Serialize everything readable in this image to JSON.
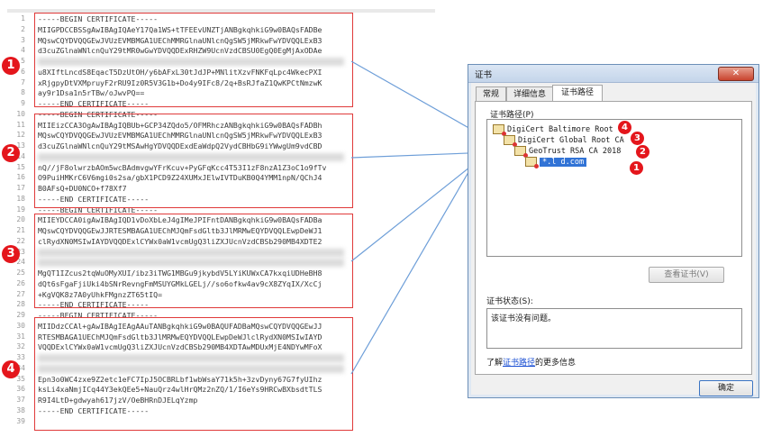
{
  "editor": {
    "line_numbers": [
      "1",
      "2",
      "3",
      "4",
      "5",
      "6",
      "7",
      "8",
      "9",
      "10",
      "11",
      "12",
      "13",
      "14",
      "15",
      "16",
      "17",
      "18",
      "19",
      "20",
      "21",
      "22",
      "23",
      "24",
      "25",
      "26",
      "27",
      "28",
      "29",
      "30",
      "31",
      "32",
      "33",
      "34",
      "35",
      "36",
      "37",
      "38",
      "39"
    ],
    "lines": [
      "-----BEGIN CERTIFICATE-----",
      "MIIGPDCCBSSgAwIBAgIQAeY17Qa1WS+tTFEEvUNZTjANBgkqhkiG9w0BAQsFADBe",
      "MQswCQYDVQQGEwJVUzEVMBMGA1UEChMMRGlnaUNlcnQgSW5jMRkwFwYDVQQLExB3",
      "d3cuZGlnaWNlcnQuY29tMR0wGwYDVQQDExRHZW9UcnVzdCBSU0EgQ0EgMjAxODAe",
      "",
      "u8XIftLncdS8EqacT5DzUtOH/y6bAFxL30tJdJP+MNlitXzvFNKFqLpc4WkecPXI",
      "xRjgpyDtVXMpruyF2rRU9Iz0R5V3G1b+Do4y9IFc8/2q+BsRJfaZ1QwKPCtNmzwK",
      "ay9r1Dsa1n5rTBw/oJwvPQ==",
      "-----END CERTIFICATE-----",
      "-----BEGIN CERTIFICATE-----",
      "MIIEizCCA3OgAwIBAgIQBUb+GCP34ZQdo5/OFMRhczANBgkqhkiG9w0BAQsFADBh",
      "MQswCQYDVQQGEwJVUzEVMBMGA1UEChMMRGlnaUNlcnQgSW5jMRkwFwYDVQQLExB3",
      "d3cuZGlnaWNlcnQuY29tMSAwHgYDVQQDExdEaWdpQ2VydCBHbG9iYWwgUm9vdCBD",
      "",
      "nQ//jF8olwrzbAOm5wcBAdmvgwYFrKcuv+PyGFqKcc4T53I1zF8nzA1Z3oC1o9fTv",
      "O9PuiHMKrC6V6mgi0s2sa/gbX1PCD9Z24XUMxJElwIVTDuKB0Q4YMM1npN/QChJ4",
      "B0AFsQ+DU0NCO+f78Xf7",
      "-----END CERTIFICATE-----",
      "-----BEGIN CERTIFICATE-----",
      "MIIEYDCCA0igAwIBAgIQD1vDoXbLeJ4gIMeJPIFntDANBgkqhkiG9w0BAQsFADBa",
      "MQswCQYDVQQGEwJJRTESMBAGA1UEChMJQmFsdGltb3JlMRMwEQYDVQQLEwpDeWJ1",
      "clRydXN0MSIwIAYDVQQDExlCYWx0aW1vcmUgQ3liZXJUcnVzdCBSb290MB4XDTE2",
      "",
      "",
      "MgQT1IZcus2tqWuOMyXUI/ibz3iTWG1MBGu9jkybdV5LYiKUWxCA7kxqiUDHeBH8",
      "dQt6sFgaFjiUki4bSNrRevngFmMSUYGMkLGELj//so6ofkw4av9cX8ZYqIX/XcCj",
      "+KgVQK8z7A0yUhkFMgnzZT65tIQ=",
      "-----END CERTIFICATE-----",
      "-----BEGIN CERTIFICATE-----",
      "MIIDdzCCAl+gAwIBAgIEAgAAuTANBgkqhkiG9w0BAQUFADBaMQswCQYDVQQGEwJJ",
      "RTESMBAGA1UEChMJQmFsdGltb3JlMRMwEQYDVQQLEwpDeWJlclRydXN0MSIwIAYD",
      "VQQDExlCYWx0aW1vcmUgQ3liZXJUcnVzdCBSb290MB4XDTAwMDUxMjE4NDYwMFoX",
      "",
      "",
      "Epn3o0WC4zxe9Z2etc1eFC7IpJ5OCBRLbf1wbWsaY71k5h+3zvDyny67G7fyUIhz",
      "ksLi4xaNmjICq44Y3ekQEe5+NauQrz4wlHrQMz2nZQ/1/I6eYs9HRCwBXbsdtTLS",
      "R9I4LtD+gdwyah617jzV/OeBHRnDJELqYzmp",
      "-----END CERTIFICATE-----",
      ""
    ]
  },
  "badges": [
    "1",
    "2",
    "3",
    "4"
  ],
  "dialog": {
    "title": "证书",
    "close_glyph": "✕",
    "tabs": [
      {
        "label": "常规"
      },
      {
        "label": "详细信息"
      },
      {
        "label": "证书路径"
      }
    ],
    "path_label": "证书路径(P)",
    "tree": [
      {
        "label": "DigiCert Baltimore Root",
        "badge": "4"
      },
      {
        "label": "DigiCert Global Root CA",
        "badge": "3"
      },
      {
        "label": "GeoTrust RSA CA 2018",
        "badge": "2"
      },
      {
        "label": "*.l        d.com",
        "badge": "1"
      }
    ],
    "view_cert_button": "查看证书(V)",
    "status_label": "证书状态(S):",
    "status_text": "该证书没有问题。",
    "learn_prefix": "了解",
    "learn_link": "证书路径",
    "learn_suffix": "的更多信息",
    "ok_button": "确定"
  },
  "colors": {
    "accent_red": "#e4161c",
    "selection_blue": "#3173d6",
    "arrow_blue": "#6d9ed8"
  }
}
